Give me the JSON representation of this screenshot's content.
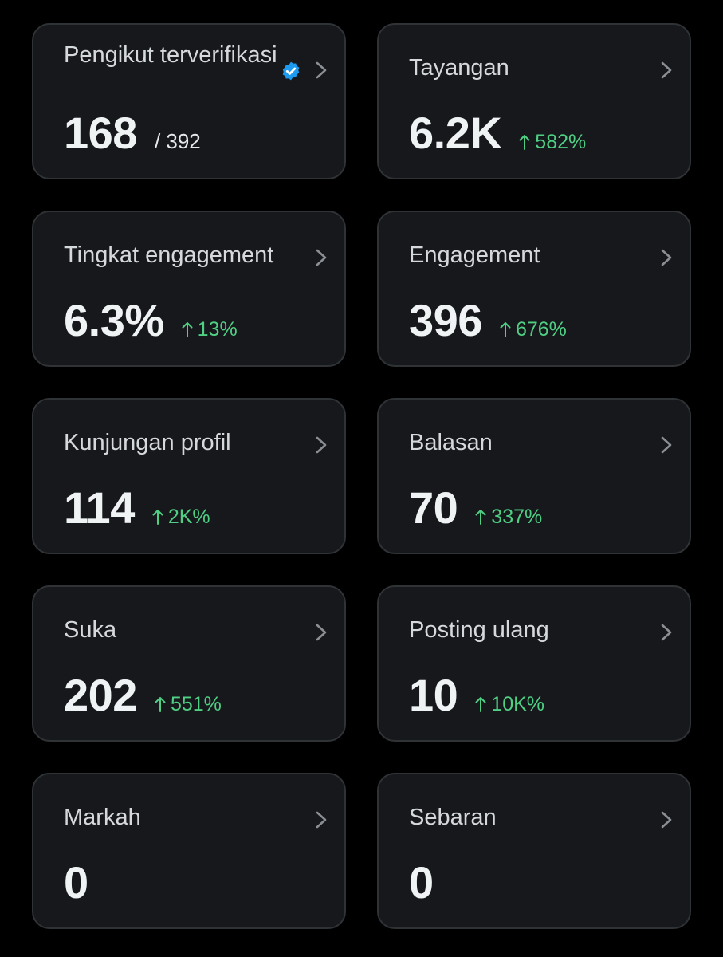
{
  "cards": [
    {
      "label": "Pengikut terverifikasi",
      "value": "168",
      "sub": "/ 392",
      "change": "",
      "verified_icon": "verified-badge-icon"
    },
    {
      "label": "Tayangan",
      "value": "6.2K",
      "change": "582%"
    },
    {
      "label": "Tingkat engagement",
      "value": "6.3%",
      "change": "13%"
    },
    {
      "label": "Engagement",
      "value": "396",
      "change": "676%"
    },
    {
      "label": "Kunjungan profil",
      "value": "114",
      "change": "2K%"
    },
    {
      "label": "Balasan",
      "value": "70",
      "change": "337%"
    },
    {
      "label": "Suka",
      "value": "202",
      "change": "551%"
    },
    {
      "label": "Posting ulang",
      "value": "10",
      "change": "10K%"
    },
    {
      "label": "Markah",
      "value": "0",
      "change": ""
    },
    {
      "label": "Sebaran",
      "value": "0",
      "change": ""
    }
  ],
  "colors": {
    "background": "#000000",
    "card": "#16181c",
    "card_border": "#2f3336",
    "positive": "#4fcf84",
    "verified": "#1d9bf0"
  },
  "icons": {
    "chevron": "chevron-right-icon",
    "change_arrow": "arrow-up-icon",
    "verified": "verified-badge-icon"
  }
}
